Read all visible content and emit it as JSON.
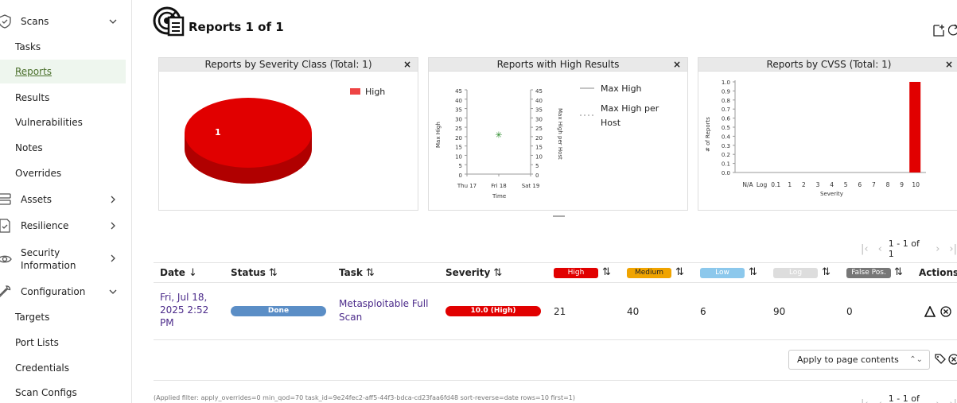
{
  "sidebar": {
    "groups": {
      "scans": "Scans",
      "assets": "Assets",
      "resilience": "Resilience",
      "security_information_1": "Security",
      "security_information_2": "Information",
      "configuration": "Configuration"
    },
    "scan_items": [
      "Tasks",
      "Reports",
      "Results",
      "Vulnerabilities",
      "Notes",
      "Overrides"
    ],
    "config_items": [
      "Targets",
      "Port Lists",
      "Credentials",
      "Scan Configs"
    ],
    "active_item": "Reports"
  },
  "header": {
    "title": "Reports 1 of 1"
  },
  "charts": {
    "severity_class": {
      "title": "Reports by Severity Class (Total: 1)",
      "close": "×",
      "legend": "High",
      "slice_label": "1"
    },
    "high_results": {
      "title": "Reports with High Results",
      "close": "×",
      "legend_1": "Max High",
      "legend_2a": "Max High per",
      "legend_2b": "Host",
      "ylabel_left": "Max High",
      "ylabel_right": "Max High per Host",
      "xlabel": "Time",
      "x_ticks": [
        "Thu 17",
        "Fri 18",
        "Sat 19"
      ],
      "y_ticks": [
        "0",
        "5",
        "10",
        "15",
        "20",
        "25",
        "30",
        "35",
        "40",
        "45"
      ]
    },
    "cvss": {
      "title": "Reports by CVSS (Total: 1)",
      "close": "×",
      "ylabel": "# of Reports",
      "xlabel": "Severity",
      "x_ticks": [
        "N/A",
        "Log",
        "0.1",
        "1",
        "2",
        "3",
        "4",
        "5",
        "6",
        "7",
        "8",
        "9",
        "10"
      ],
      "y_ticks": [
        "0.0",
        "0.1",
        "0.2",
        "0.3",
        "0.4",
        "0.5",
        "0.6",
        "0.7",
        "0.8",
        "0.9",
        "1.0"
      ]
    }
  },
  "pagination": {
    "top": "1 - 1 of 1",
    "bottom": "1 - 1 of 1"
  },
  "table": {
    "headers": {
      "date": "Date",
      "status": "Status",
      "task": "Task",
      "severity": "Severity",
      "high": "High",
      "medium": "Medium",
      "low": "Low",
      "log": "Log",
      "false_pos": "False Pos.",
      "actions": "Actions"
    },
    "sort_icons": {
      "date": "↓",
      "other": "⇅"
    },
    "row": {
      "date_1": "Fri, Jul 18,",
      "date_2": "2025 2:52",
      "date_3": "PM",
      "status": "Done",
      "task_1": "Metasploitable Full",
      "task_2": "Scan",
      "severity": "10.0 (High)",
      "high": "21",
      "medium": "40",
      "low": "6",
      "log": "90",
      "false_pos": "0"
    }
  },
  "apply_select": {
    "value": "Apply to page contents"
  },
  "filter_text": "(Applied filter: apply_overrides=0 min_qod=70 task_id=9e24fec2-aff5-44f3-bdca-cd23faa6fd48 sort-reverse=date rows=10 first=1)",
  "chart_data": [
    {
      "type": "pie",
      "title": "Reports by Severity Class (Total: 1)",
      "categories": [
        "High"
      ],
      "values": [
        1
      ],
      "colors": [
        "#e10000"
      ]
    },
    {
      "type": "scatter",
      "title": "Reports with High Results",
      "xlabel": "Time",
      "ylabel": "Max High",
      "x": [
        "Fri 18"
      ],
      "series": [
        {
          "name": "Max High",
          "values": [
            21
          ]
        }
      ],
      "ylim": [
        0,
        45
      ]
    },
    {
      "type": "bar",
      "title": "Reports by CVSS (Total: 1)",
      "xlabel": "Severity",
      "ylabel": "# of Reports",
      "categories": [
        "N/A",
        "Log",
        "0.1",
        "1",
        "2",
        "3",
        "4",
        "5",
        "6",
        "7",
        "8",
        "9",
        "10"
      ],
      "values": [
        0,
        0,
        0,
        0,
        0,
        0,
        0,
        0,
        0,
        0,
        0,
        0,
        1
      ],
      "ylim": [
        0,
        1.0
      ]
    }
  ],
  "colors": {
    "high": "#e10000",
    "medium": "#f0a400",
    "low": "#8cc8ec",
    "log": "#dddddd",
    "false_pos": "#777777",
    "done": "#5b8ec6"
  }
}
